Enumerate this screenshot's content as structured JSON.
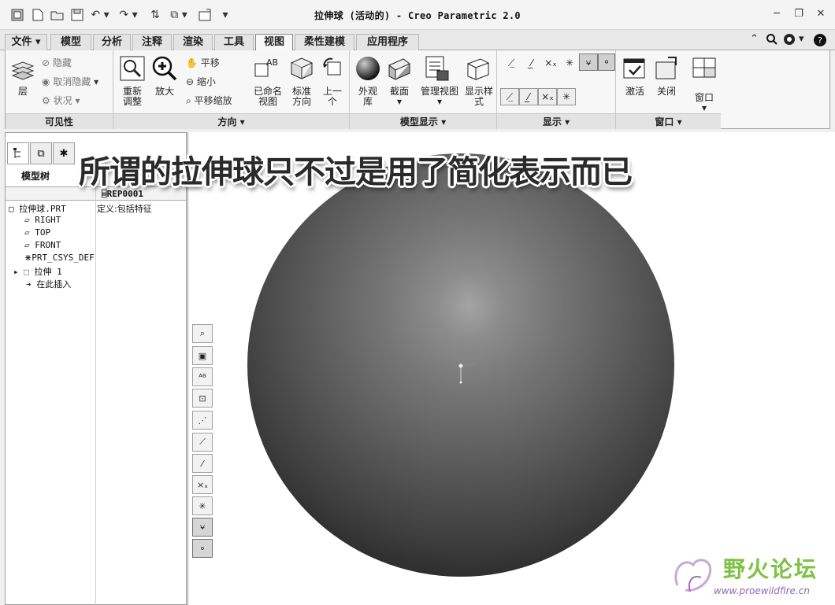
{
  "window": {
    "title": "拉伸球 (活动的) - Creo Parametric 2.0",
    "buttons": [
      "─",
      "❐",
      "✕"
    ]
  },
  "quick_access": [
    "app-icon",
    "new-icon",
    "open-icon",
    "save-icon",
    "undo-icon",
    "redo-icon",
    "regenerate-icon",
    "window-icon",
    "close-window-icon",
    "customize-icon"
  ],
  "menu": {
    "tabs": [
      "文件",
      "模型",
      "分析",
      "注释",
      "渲染",
      "工具",
      "视图",
      "柔性建模",
      "应用程序"
    ],
    "active_tab": "视图",
    "right_icons": [
      "minimize-ribbon-icon",
      "search-icon",
      "help-icon",
      "help-center-icon"
    ]
  },
  "ribbon": {
    "visibility": {
      "label": "可见性",
      "layer": "层",
      "hide": "隐藏",
      "unhide": "取消隐藏",
      "status": "状况"
    },
    "orientation": {
      "label": "方向",
      "refit": "重新\n调整",
      "zoom_in": "放大",
      "pan": "平移",
      "zoom_out": "缩小",
      "pan_zoom": "平移缩放",
      "named_views": "已命名\n视图",
      "standard": "标准\n方向",
      "previous": "上一\n个"
    },
    "model_display": {
      "label": "模型显示",
      "appearance": "外观\n库",
      "section": "截面",
      "manage_views": "管理视图",
      "display_style": "显示样\n式"
    },
    "show": {
      "label": "显示"
    },
    "window": {
      "label": "窗口",
      "activate": "激活",
      "close": "关闭",
      "windows": "窗口"
    }
  },
  "left_panel": {
    "tabs": [
      "model-tree-icon",
      "folder-browser-icon",
      "favorites-icon"
    ],
    "title": "模型树",
    "column_header": "REP0001",
    "rows": [
      {
        "label": "拉伸球.PRT",
        "value": "定义:包括特征",
        "icon": "part-icon"
      },
      {
        "label": "RIGHT",
        "value": "",
        "icon": "datum-plane-icon"
      },
      {
        "label": "TOP",
        "value": "",
        "icon": "datum-plane-icon"
      },
      {
        "label": "FRONT",
        "value": "",
        "icon": "datum-plane-icon"
      },
      {
        "label": "PRT_CSYS_DEF",
        "value": "",
        "icon": "csys-icon"
      },
      {
        "label": "拉伸 1",
        "value": "",
        "icon": "extrude-icon"
      },
      {
        "label": "在此插入",
        "value": "",
        "icon": "insert-arrow-icon"
      }
    ]
  },
  "viewport": {
    "caption": "所谓的拉伸球只不过是用了简化表示而已",
    "watermark_title": "野火论坛",
    "watermark_url": "www.proewildfire.cn"
  },
  "colors": {
    "accent": "#9b6fb5",
    "watermark_green": "#7dc242"
  }
}
